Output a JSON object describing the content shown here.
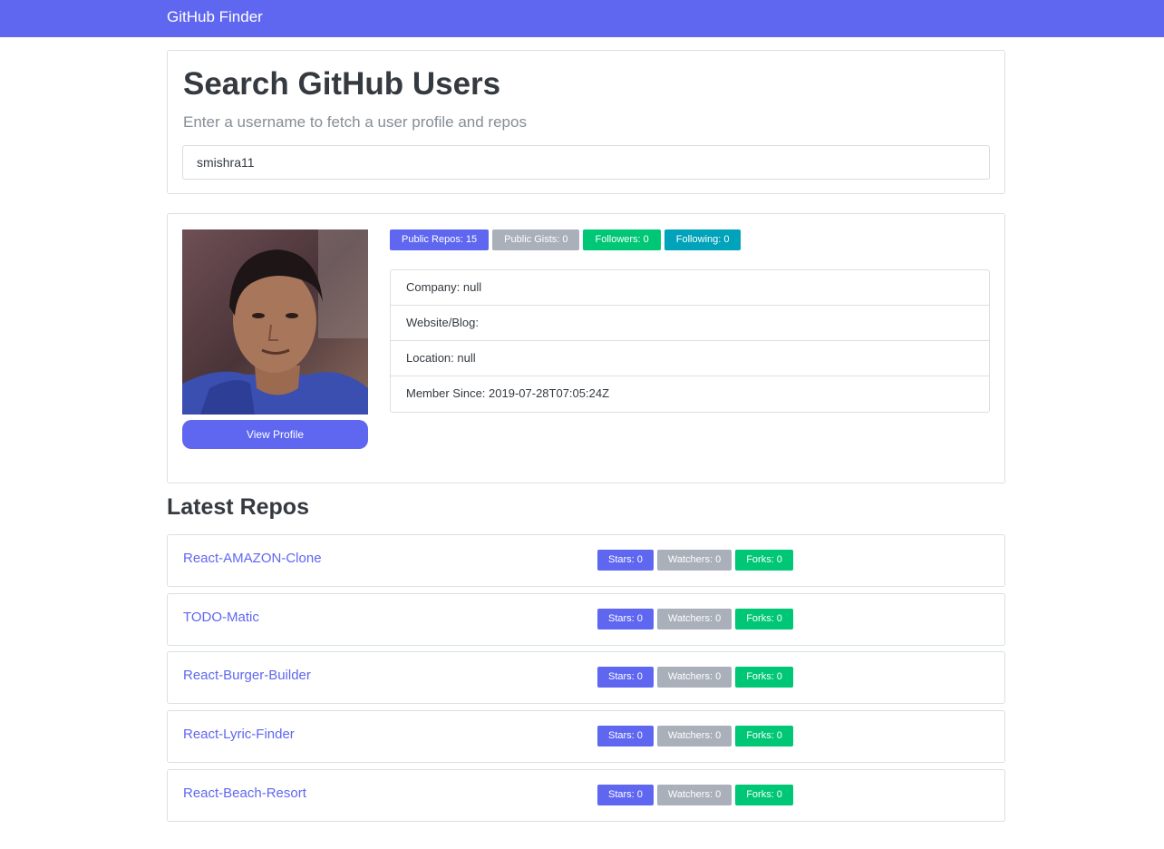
{
  "navbar": {
    "brand": "GitHub Finder"
  },
  "search": {
    "title": "Search GitHub Users",
    "subtitle": "Enter a username to fetch a user profile and repos",
    "value": "smishra11"
  },
  "profile": {
    "view_profile_label": "View Profile",
    "badges": {
      "public_repos": "Public Repos: 15",
      "public_gists": "Public Gists: 0",
      "followers": "Followers: 0",
      "following": "Following: 0"
    },
    "info": {
      "company": "Company: null",
      "website": "Website/Blog:",
      "location": "Location: null",
      "member_since": "Member Since: 2019-07-28T07:05:24Z"
    }
  },
  "repos": {
    "title": "Latest Repos",
    "items": [
      {
        "name": "React-AMAZON-Clone",
        "stars": "Stars: 0",
        "watchers": "Watchers: 0",
        "forks": "Forks: 0"
      },
      {
        "name": "TODO-Matic",
        "stars": "Stars: 0",
        "watchers": "Watchers: 0",
        "forks": "Forks: 0"
      },
      {
        "name": "React-Burger-Builder",
        "stars": "Stars: 0",
        "watchers": "Watchers: 0",
        "forks": "Forks: 0"
      },
      {
        "name": "React-Lyric-Finder",
        "stars": "Stars: 0",
        "watchers": "Watchers: 0",
        "forks": "Forks: 0"
      },
      {
        "name": "React-Beach-Resort",
        "stars": "Stars: 0",
        "watchers": "Watchers: 0",
        "forks": "Forks: 0"
      }
    ]
  },
  "colors": {
    "primary": "#5f67f0",
    "secondary": "#aab0ba",
    "success": "#00c776",
    "info": "#00a3ba"
  }
}
